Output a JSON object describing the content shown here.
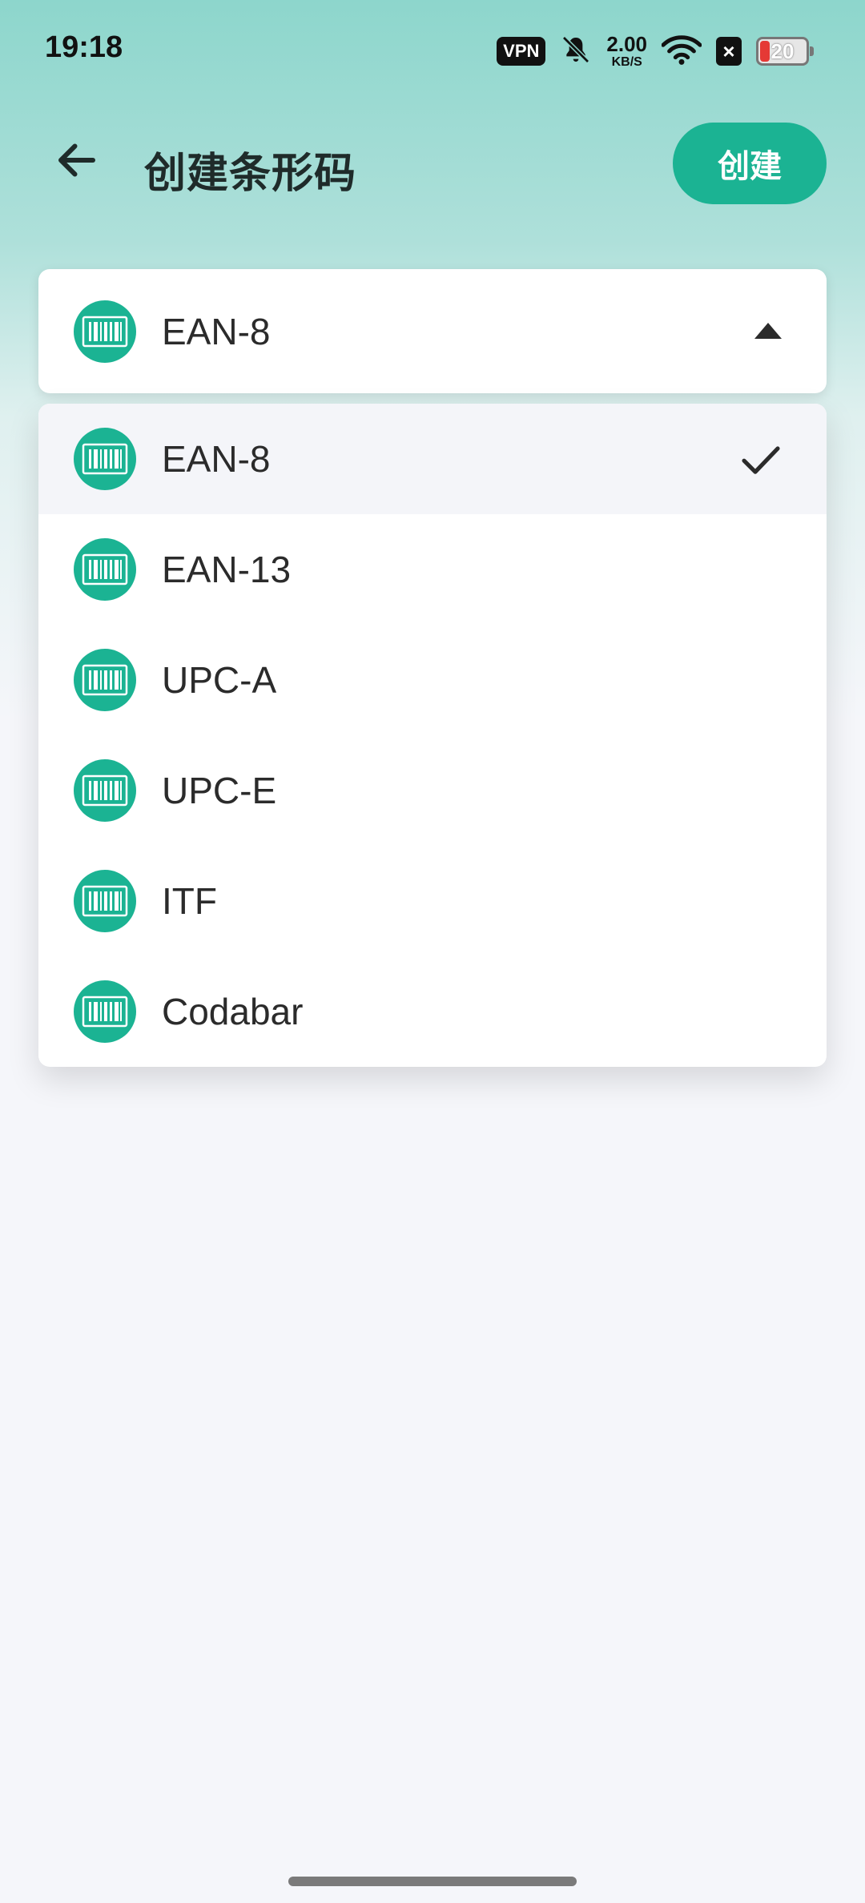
{
  "status_bar": {
    "time": "19:18",
    "vpn": "VPN",
    "speed_value": "2.00",
    "speed_unit": "KB/S",
    "battery_level": "20",
    "x_badge": "×"
  },
  "app_bar": {
    "back_icon": "arrow-left-icon",
    "title": "创建条形码",
    "create_label": "创建"
  },
  "selector": {
    "selected_label": "EAN-8",
    "icon": "barcode-icon",
    "expanded_indicator": "caret-up-icon"
  },
  "dropdown": {
    "selected_index": 0,
    "items": [
      {
        "label": "EAN-8"
      },
      {
        "label": "EAN-13"
      },
      {
        "label": "UPC-A"
      },
      {
        "label": "UPC-E"
      },
      {
        "label": "ITF"
      },
      {
        "label": "Codabar"
      }
    ]
  },
  "colors": {
    "accent": "#1bb393",
    "header_gradient_top": "#8dd6cc",
    "background": "#f5f6fa",
    "battery_low": "#e53935"
  }
}
